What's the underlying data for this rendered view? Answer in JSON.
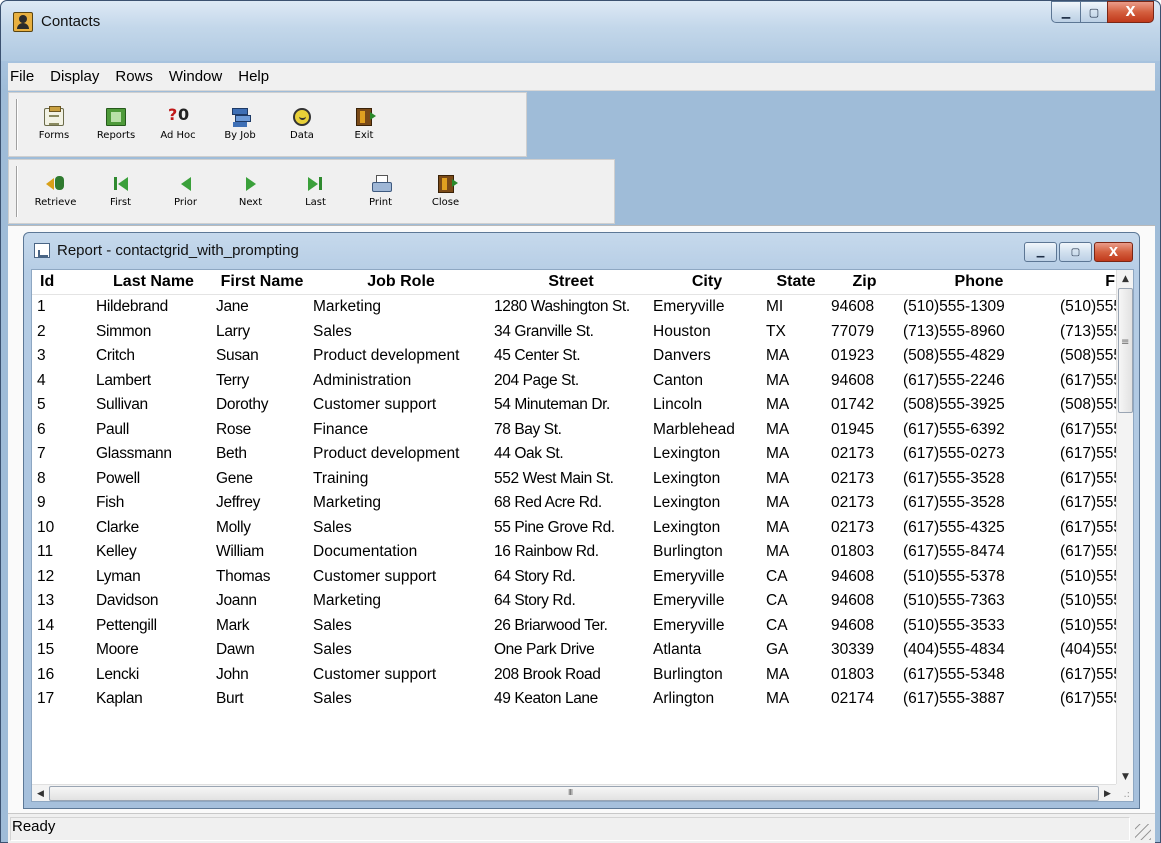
{
  "app": {
    "title": "Contacts",
    "controls": {
      "minimize": "▁",
      "maximize": "▢",
      "close": "X"
    }
  },
  "menu": [
    "File",
    "Display",
    "Rows",
    "Window",
    "Help"
  ],
  "toolbar_main": [
    {
      "label": "Forms",
      "icon": "forms-icon"
    },
    {
      "label": "Reports",
      "icon": "reports-icon"
    },
    {
      "label": "Ad Hoc",
      "icon": "adhoc-icon"
    },
    {
      "label": "By Job",
      "icon": "byjob-icon"
    },
    {
      "label": "Data",
      "icon": "data-icon"
    },
    {
      "label": "Exit",
      "icon": "exit-icon"
    }
  ],
  "toolbar_nav": [
    {
      "label": "Retrieve",
      "icon": "retrieve-icon"
    },
    {
      "label": "First",
      "icon": "first-icon"
    },
    {
      "label": "Prior",
      "icon": "prior-icon"
    },
    {
      "label": "Next",
      "icon": "next-icon"
    },
    {
      "label": "Last",
      "icon": "last-icon"
    },
    {
      "label": "Print",
      "icon": "print-icon"
    },
    {
      "label": "Close",
      "icon": "close-door-icon"
    }
  ],
  "report": {
    "title": "Report - contactgrid_with_prompting",
    "controls": {
      "minimize": "▁",
      "maximize": "▢",
      "close": "X"
    },
    "columns": [
      "Id",
      "Last Name",
      "First Name",
      "Job Role",
      "Street",
      "City",
      "State",
      "Zip",
      "Phone",
      "F"
    ],
    "rows": [
      [
        "1",
        "Hildebrand",
        "Jane",
        "Marketing",
        "1280 Washington St.",
        "Emeryville",
        "MI",
        "94608",
        "(510)555-1309",
        "(510)555"
      ],
      [
        "2",
        "Simmon",
        "Larry",
        "Sales",
        "34 Granville St.",
        "Houston",
        "TX",
        "77079",
        "(713)555-8960",
        "(713)555"
      ],
      [
        "3",
        "Critch",
        "Susan",
        "Product development",
        "45 Center St.",
        "Danvers",
        "MA",
        "01923",
        "(508)555-4829",
        "(508)555"
      ],
      [
        "4",
        "Lambert",
        "Terry",
        "Administration",
        "204 Page St.",
        "Canton",
        "MA",
        "94608",
        "(617)555-2246",
        "(617)555"
      ],
      [
        "5",
        "Sullivan",
        "Dorothy",
        "Customer support",
        "54 Minuteman Dr.",
        "Lincoln",
        "MA",
        "01742",
        "(508)555-3925",
        "(508)555"
      ],
      [
        "6",
        "Paull",
        "Rose",
        "Finance",
        "78 Bay St.",
        "Marblehead",
        "MA",
        "01945",
        "(617)555-6392",
        "(617)555"
      ],
      [
        "7",
        "Glassmann",
        "Beth",
        "Product development",
        "44 Oak St.",
        "Lexington",
        "MA",
        "02173",
        "(617)555-0273",
        "(617)555"
      ],
      [
        "8",
        "Powell",
        "Gene",
        "Training",
        "552 West Main St.",
        "Lexington",
        "MA",
        "02173",
        "(617)555-3528",
        "(617)555"
      ],
      [
        "9",
        "Fish",
        "Jeffrey",
        "Marketing",
        "68 Red Acre Rd.",
        "Lexington",
        "MA",
        "02173",
        "(617)555-3528",
        "(617)555"
      ],
      [
        "10",
        "Clarke",
        "Molly",
        "Sales",
        "55 Pine Grove Rd.",
        "Lexington",
        "MA",
        "02173",
        "(617)555-4325",
        "(617)555"
      ],
      [
        "11",
        "Kelley",
        "William",
        "Documentation",
        "16 Rainbow Rd.",
        "Burlington",
        "MA",
        "01803",
        "(617)555-8474",
        "(617)555"
      ],
      [
        "12",
        "Lyman",
        "Thomas",
        "Customer support",
        "64 Story Rd.",
        "Emeryville",
        "CA",
        "94608",
        "(510)555-5378",
        "(510)555"
      ],
      [
        "13",
        "Davidson",
        "Joann",
        "Marketing",
        "64 Story Rd.",
        "Emeryville",
        "CA",
        "94608",
        "(510)555-7363",
        "(510)555"
      ],
      [
        "14",
        "Pettengill",
        "Mark",
        "Sales",
        "26 Briarwood Ter.",
        "Emeryville",
        "CA",
        "94608",
        "(510)555-3533",
        "(510)555"
      ],
      [
        "15",
        "Moore",
        "Dawn",
        "Sales",
        "One Park Drive",
        "Atlanta",
        "GA",
        "30339",
        "(404)555-4834",
        "(404)555"
      ],
      [
        "16",
        "Lencki",
        "John",
        "Customer support",
        "208 Brook Road",
        "Burlington",
        "MA",
        "01803",
        "(617)555-5348",
        "(617)555"
      ],
      [
        "17",
        "Kaplan",
        "Burt",
        "Sales",
        "49 Keaton Lane",
        "Arlington",
        "MA",
        "02174",
        "(617)555-3887",
        "(617)555"
      ]
    ]
  },
  "status": {
    "text": "Ready"
  },
  "colors": {
    "accent": "#a9c4df",
    "close_button": "#c0391b",
    "background": "#ffffff"
  }
}
